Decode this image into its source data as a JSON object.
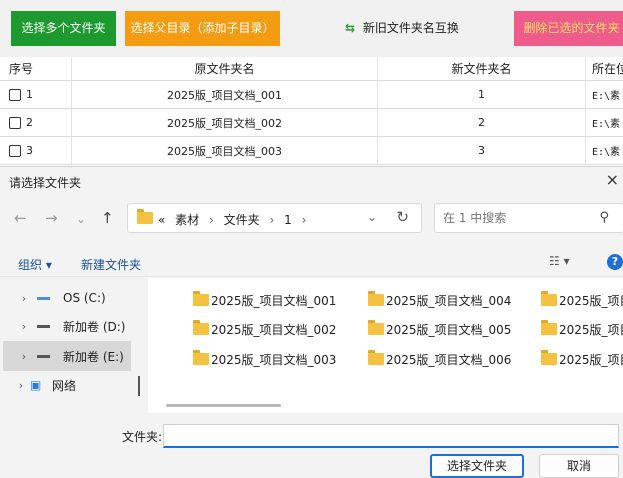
{
  "toolbar": {
    "select_multiple": "选择多个文件夹",
    "select_parent": "选择父目录（添加子目录）",
    "swap_names": "新旧文件夹名互换",
    "delete_selected": "删除已选的文件夹",
    "swap_icon": "recycle-arrows-icon"
  },
  "table": {
    "headers": [
      "序号",
      "原文件夹名",
      "新文件夹名",
      "所在位"
    ],
    "rows": [
      {
        "index": "1",
        "original": "2025版_项目文档_001",
        "new": "1",
        "location": "E:\\素"
      },
      {
        "index": "2",
        "original": "2025版_项目文档_002",
        "new": "2",
        "location": "E:\\素"
      },
      {
        "index": "3",
        "original": "2025版_项目文档_003",
        "new": "3",
        "location": "E:\\素"
      }
    ]
  },
  "dialog": {
    "title": "请选择文件夹",
    "close": "×",
    "address": {
      "prefix": "«",
      "crumbs": [
        "素材",
        "文件夹",
        "1"
      ],
      "separator": "›"
    },
    "search": {
      "placeholder": "在 1 中搜索"
    },
    "commands": {
      "organize": "组织 ▾",
      "new_folder": "新建文件夹"
    },
    "nav": [
      {
        "label": "OS (C:)",
        "icon": "windows-drive-icon"
      },
      {
        "label": "新加卷 (D:)",
        "icon": "drive-icon"
      },
      {
        "label": "新加卷 (E:)",
        "icon": "drive-icon",
        "selected": true
      },
      {
        "label": "网络",
        "icon": "network-icon"
      }
    ],
    "files": [
      [
        "2025版_项目文档_001",
        "2025版_项目文档_004",
        "2025版_项目"
      ],
      [
        "2025版_项目文档_002",
        "2025版_项目文档_005",
        "2025版_项目"
      ],
      [
        "2025版_项目文档_003",
        "2025版_项目文档_006",
        "2025版_项目"
      ]
    ],
    "folder_label": "文件夹:",
    "folder_value": "",
    "ok": "选择文件夹",
    "cancel": "取消"
  }
}
